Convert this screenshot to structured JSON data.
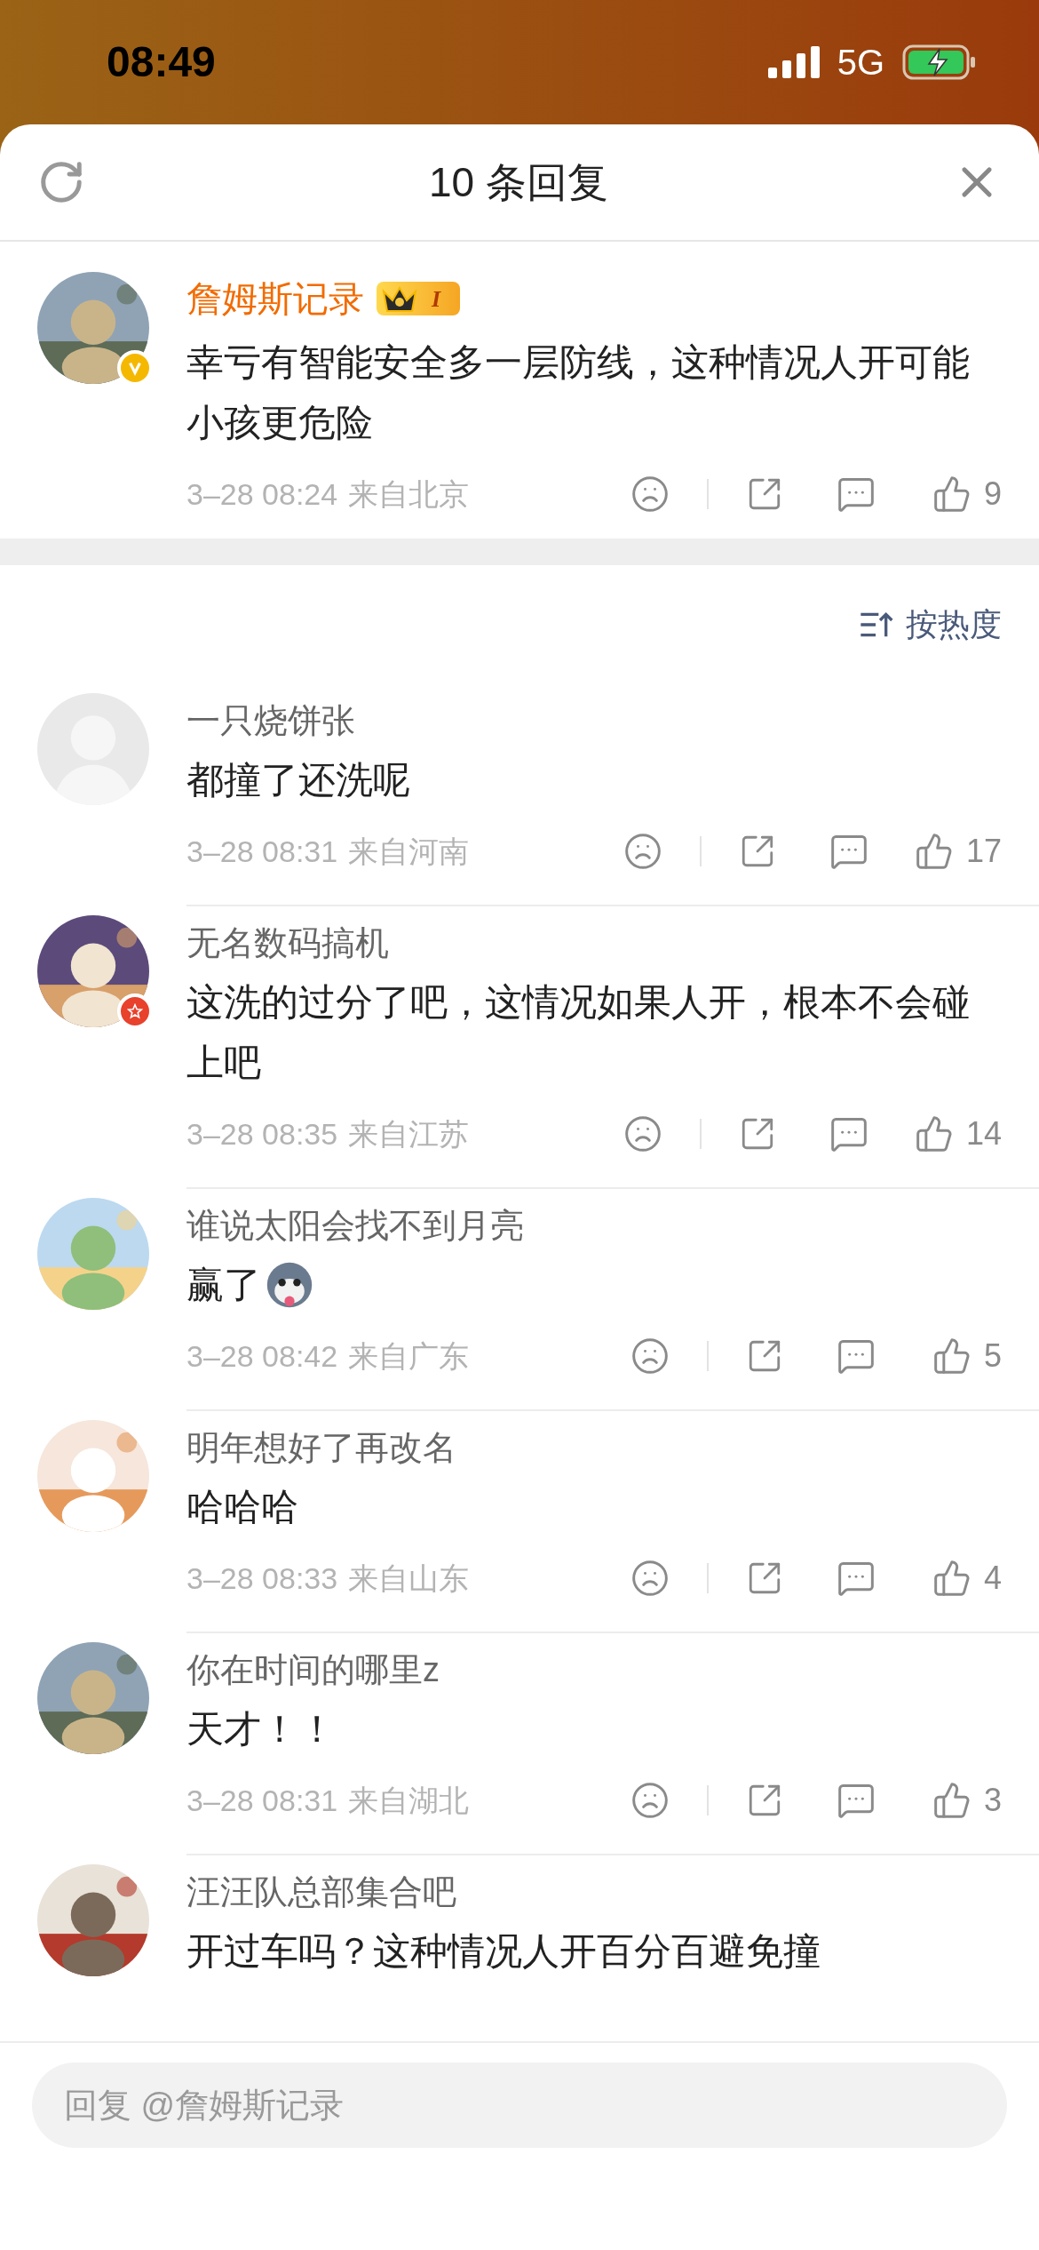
{
  "status_bar": {
    "time": "08:49",
    "network": "5G"
  },
  "header": {
    "title": "10 条回复"
  },
  "main_comment": {
    "name": "詹姆斯记录",
    "level_badge": "I",
    "default_avatar": false,
    "verified": true,
    "star_badge": false,
    "text": "幸亏有智能安全多一层防线，这种情况人开可能小孩更危险",
    "time": "3–28 08:24",
    "location": "来自北京",
    "likes": "9"
  },
  "sort": {
    "label": "按热度"
  },
  "replies": [
    {
      "name": "一只烧饼张",
      "default_avatar": true,
      "verified": false,
      "star_badge": false,
      "text": "都撞了还洗呢",
      "time": "3–28 08:31",
      "location": "来自河南",
      "likes": "17"
    },
    {
      "name": "无名数码搞机",
      "default_avatar": false,
      "verified": false,
      "star_badge": true,
      "text": "这洗的过分了吧，这情况如果人开，根本不会碰上吧",
      "time": "3–28 08:35",
      "location": "来自江苏",
      "likes": "14"
    },
    {
      "name": "谁说太阳会找不到月亮",
      "default_avatar": false,
      "verified": false,
      "star_badge": false,
      "text": "赢了",
      "sticker": true,
      "time": "3–28 08:42",
      "location": "来自广东",
      "likes": "5"
    },
    {
      "name": "明年想好了再改名",
      "default_avatar": false,
      "verified": false,
      "star_badge": false,
      "text": "哈哈哈",
      "time": "3–28 08:33",
      "location": "来自山东",
      "likes": "4"
    },
    {
      "name": "你在时间的哪里z",
      "default_avatar": false,
      "verified": false,
      "star_badge": false,
      "text": "天才！！",
      "time": "3–28 08:31",
      "location": "来自湖北",
      "likes": "3"
    },
    {
      "name": "汪汪队总部集合吧",
      "default_avatar": false,
      "verified": false,
      "star_badge": false,
      "text": "开过车吗？这种情况人开百分百避免撞"
    }
  ],
  "reply_field": {
    "placeholder": "回复 @詹姆斯记录"
  }
}
